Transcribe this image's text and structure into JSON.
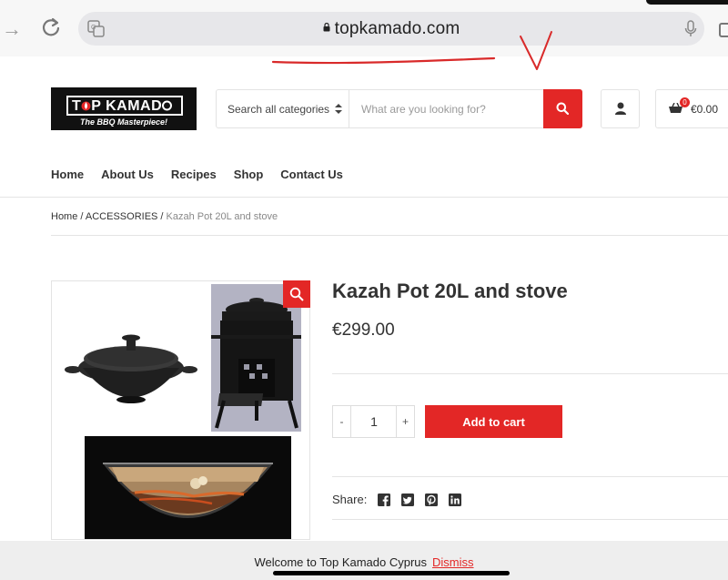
{
  "browser": {
    "url": "topkamado.com"
  },
  "header": {
    "logo_text": "TOP KAMADO",
    "logo_tagline": "The BBQ Masterpiece!",
    "search": {
      "category_label": "Search all categories",
      "placeholder": "What are you looking for?"
    },
    "cart": {
      "count": "0",
      "total": "€0.00"
    }
  },
  "menu": {
    "items": [
      "Home",
      "About Us",
      "Recipes",
      "Shop",
      "Contact Us"
    ]
  },
  "breadcrumb": {
    "home": "Home",
    "sep1": " / ",
    "category": "ACCESSORIES",
    "sep2": " / ",
    "current": "Kazah Pot 20L and stove"
  },
  "product": {
    "title": "Kazah Pot 20L and stove",
    "price": "€299.00",
    "quantity": "1",
    "minus_label": "-",
    "plus_label": "+",
    "add_to_cart_label": "Add to cart",
    "share_label": "Share:",
    "share_icons": [
      "facebook-icon",
      "twitter-icon",
      "pinterest-icon",
      "linkedin-icon"
    ]
  },
  "notice": {
    "text": "Welcome to Top Kamado Cyprus",
    "dismiss_label": "Dismiss"
  },
  "colors": {
    "accent_red": "#e32726",
    "text_dark": "#333333",
    "border": "#e3e3e3"
  }
}
